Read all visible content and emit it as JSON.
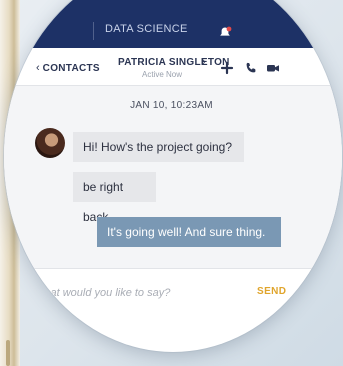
{
  "header": {
    "title": "DATA SCIENCE"
  },
  "contact_bar": {
    "back_label": "CONTACTS",
    "contact_name": "PATRICIA SINGLETON",
    "status": "Active Now"
  },
  "conversation": {
    "timestamp": "JAN 10, 10:23AM",
    "messages": [
      {
        "direction": "incoming",
        "text": "Hi! How's the project going?"
      },
      {
        "direction": "incoming",
        "text": "be right back"
      },
      {
        "direction": "outgoing",
        "text": "It's going well! And sure thing."
      }
    ]
  },
  "composer": {
    "placeholder": "What would you like to say?",
    "send_label": "SEND"
  },
  "colors": {
    "nav_bg": "#1d3166",
    "outgoing_bubble": "#7a98b4",
    "incoming_bubble": "#e6e7ea",
    "send_accent": "#e0a52c",
    "alert_accent": "#e24a4a"
  },
  "icons": [
    "bell-icon",
    "chevron-left-icon",
    "chevron-right-icon",
    "plus-icon",
    "phone-icon",
    "video-icon"
  ]
}
